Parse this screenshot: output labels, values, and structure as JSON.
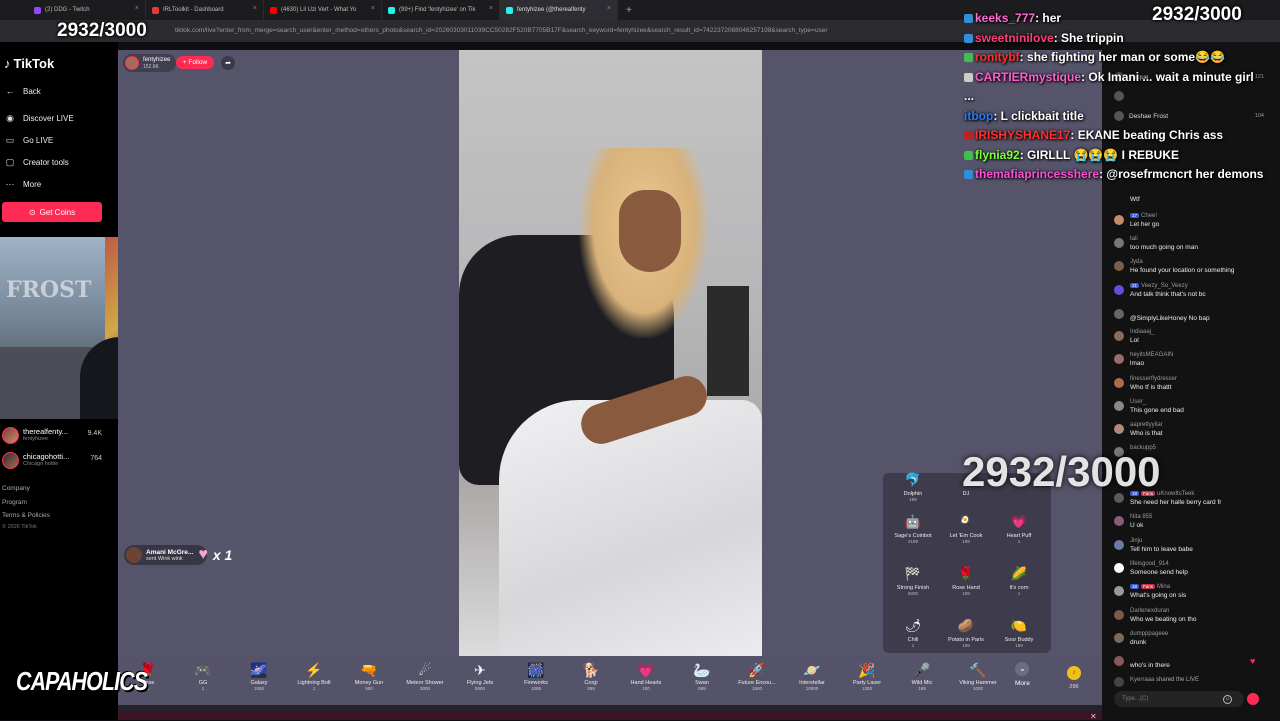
{
  "counter": "2932/3000",
  "browser": {
    "tabs": [
      {
        "label": "(2) DDG - Twitch",
        "color": "#9146ff"
      },
      {
        "label": "IRLToolkit - Dashboard",
        "color": "#e23a3a"
      },
      {
        "label": "(4630) Lil Uzi Vert - What Yo",
        "color": "#ff0000"
      },
      {
        "label": "(99+) Find 'fentyhizee' on Tik",
        "color": "#25f4ee"
      },
      {
        "label": "fentyhizee (@therealfenty",
        "color": "#25f4ee"
      }
    ],
    "url": "tiktok.com/live?enter_from_merge=search_user&enter_method=others_photo&search_id=20260303011039CC50282F520B7705B17F&search_keyword=fentyhizee&search_result_id=7422372088046257198&search_type=user"
  },
  "sidebar": {
    "logo": "TikTok",
    "back": "Back",
    "nav": [
      {
        "label": "Discover LIVE",
        "icon": "live-icon"
      },
      {
        "label": "Go LIVE",
        "icon": "camera-icon"
      },
      {
        "label": "Creator tools",
        "icon": "tools-icon"
      },
      {
        "label": "More",
        "icon": "more-icon"
      }
    ],
    "coins_button": "Get Coins",
    "following": [
      {
        "name": "therealfenty...",
        "sub": "fentyhizee",
        "count": "9.4K"
      },
      {
        "name": "chicagohotti...",
        "sub": "Chicago hottie",
        "count": "764"
      }
    ],
    "footer": [
      "Company",
      "Program",
      "Terms & Policies",
      "© 2026 TikTok"
    ]
  },
  "stream": {
    "host_name": "fentyhizee",
    "host_likes": "152.6K",
    "follow_label": "+ Follow",
    "gift_note": {
      "name": "Amani McGre...",
      "action": "sent Wink wink",
      "multiplier": "x 1"
    }
  },
  "gift_popup": [
    {
      "name": "Dolphin",
      "price": "199",
      "icon": "🐬"
    },
    {
      "name": "DJ",
      "price": "",
      "icon": ""
    },
    {
      "name": "",
      "price": "",
      "icon": ""
    },
    {
      "name": "Sage's Coinbot",
      "price": "2199",
      "icon": "🤖"
    },
    {
      "name": "Let 'Em Cook",
      "price": "199",
      "icon": "🍳"
    },
    {
      "name": "Heart Puff",
      "price": "1",
      "icon": "💗"
    },
    {
      "name": "Strong Finish",
      "price": "6000",
      "icon": "🏁"
    },
    {
      "name": "Rose Hand",
      "price": "199",
      "icon": "🌹"
    },
    {
      "name": "It's corn",
      "price": "1",
      "icon": "🌽"
    },
    {
      "name": "Chili",
      "price": "1",
      "icon": "🌶"
    },
    {
      "name": "Potato in Paris",
      "price": "199",
      "icon": "🥔"
    },
    {
      "name": "Sour Buddy",
      "price": "199",
      "icon": "🍋"
    }
  ],
  "gift_bar": [
    {
      "name": "Rose",
      "price": "1",
      "icon": "🌹"
    },
    {
      "name": "GG",
      "price": "1",
      "icon": "🎮"
    },
    {
      "name": "Galaxy",
      "price": "1000",
      "icon": "🌌"
    },
    {
      "name": "Lightning Bolt",
      "price": "1",
      "icon": "⚡"
    },
    {
      "name": "Money Gun",
      "price": "500",
      "icon": "🔫"
    },
    {
      "name": "Meteor Shower",
      "price": "3000",
      "icon": "☄"
    },
    {
      "name": "Flying Jets",
      "price": "5000",
      "icon": "✈"
    },
    {
      "name": "Fireworks",
      "price": "1088",
      "icon": "🎆"
    },
    {
      "name": "Corgi",
      "price": "299",
      "icon": "🐕"
    },
    {
      "name": "Hand Hearts",
      "price": "100",
      "icon": "💗"
    },
    {
      "name": "Swan",
      "price": "699",
      "icon": "🦢"
    },
    {
      "name": "Future Encou...",
      "price": "1500",
      "icon": "🚀"
    },
    {
      "name": "Interstellar",
      "price": "10000",
      "icon": "🪐"
    },
    {
      "name": "Party Laser",
      "price": "1300",
      "icon": "🎉"
    },
    {
      "name": "Wild Mic",
      "price": "199",
      "icon": "🎤"
    },
    {
      "name": "Viking Hammer",
      "price": "1000",
      "icon": "🔨"
    }
  ],
  "more_label": "More",
  "coin_balance": "296",
  "watermark": "CAPAHOLICS",
  "overlay_chat": [
    {
      "user": "keeks_777",
      "text": "her",
      "color": "#ff6ad5",
      "badge": "#2f8fd8"
    },
    {
      "user": "sweetninilove",
      "text": "She trippin",
      "color": "#ff3c7a",
      "badge": "#2f8fd8"
    },
    {
      "user": "ronitybf",
      "text": "she fighting her man or some😂😂",
      "color": "#ff3030",
      "badge": "#3fbf4f"
    },
    {
      "user": "CARTIERmystique",
      "text": "Ok Imani ... wait a minute girl ...",
      "color": "#ff5fd0",
      "badge": "#cccccc"
    },
    {
      "user": "itbop",
      "text": "L clickbait title",
      "color": "#2b7cf0",
      "badge": ""
    },
    {
      "user": "IRISHYSHANE17",
      "text": "EKANE beating Chris ass",
      "color": "#ff3030",
      "badge": "#bb2222"
    },
    {
      "user": "flynia92",
      "text": "GIRLLL 😭😭😭 I REBUKE",
      "color": "#7fff3a",
      "badge": "#3fbf4f"
    },
    {
      "user": "themafiaprincesshere",
      "text": "@rosefrmcncrt her demons",
      "color": "#ff4fd8",
      "badge": "#2f8fd8"
    }
  ],
  "rankings": [
    {
      "name": "unique",
      "value": "121"
    },
    {
      "name": "",
      "value": ""
    },
    {
      "name": "Deshae Frost",
      "value": "104"
    }
  ],
  "chat": [
    {
      "user": "",
      "text": "Wtf",
      "color": "#777"
    },
    {
      "user": "Chee!",
      "level": "17",
      "text": "Let her go",
      "color": "#c78b6a"
    },
    {
      "user": "tali",
      "text": "too much going on man",
      "color": "#777"
    },
    {
      "user": "Jyda",
      "text": "He found your location or something",
      "color": "#7a5d4a"
    },
    {
      "user": "Veezy_So_Veezy",
      "level": "21",
      "text": "And talk think that's not bc",
      "color": "#6a4ae0"
    },
    {
      "user": "",
      "text": "@SimplyLikeHoney No bap",
      "color": "#666"
    },
    {
      "user": "Indiaaaj_",
      "text": "Lol",
      "color": "#8a6a5a"
    },
    {
      "user": "heyitsMEAGAIN",
      "text": "lmao",
      "color": "#9a6b6b"
    },
    {
      "user": "finesserflydresser",
      "text": "Who tf is thattt",
      "color": "#b06a4a"
    },
    {
      "user": "User_",
      "text": "This gone end bad",
      "color": "#888"
    },
    {
      "user": "aaprettyyliar",
      "text": "Who is that",
      "color": "#b08a7a"
    },
    {
      "user": "backupp5",
      "text": "",
      "color": "#777"
    },
    {
      "user": "uKnowItsTeek",
      "level": "19",
      "fan": "Fans",
      "text": "She need her halle berry card fr",
      "color": "#5a5a5a"
    },
    {
      "user": "Nita 855",
      "text": "U ok",
      "color": "#8a5a7a"
    },
    {
      "user": "Jinju",
      "text": "Tell him to leave babe",
      "color": "#6a7aa0"
    },
    {
      "user": "lifeisgood_914",
      "text": "Someone send help",
      "color": "#ffffff"
    },
    {
      "user": "Mina",
      "level": "18",
      "fan": "Fans",
      "text": "What's going on sis",
      "color": "#9a9a9a"
    },
    {
      "user": "Darlenexduran",
      "text": "Who we beating on tho",
      "color": "#7a5a4a"
    },
    {
      "user": "dumpppageee",
      "text": "drunk",
      "color": "#7a6a5a"
    },
    {
      "user": "",
      "text": "who's in there",
      "color": "#8a5a5a"
    },
    {
      "user": "Kyerraaa",
      "text": "shared the LIVE",
      "color": "#999"
    }
  ],
  "chat_input_placeholder": "Type...(C)"
}
